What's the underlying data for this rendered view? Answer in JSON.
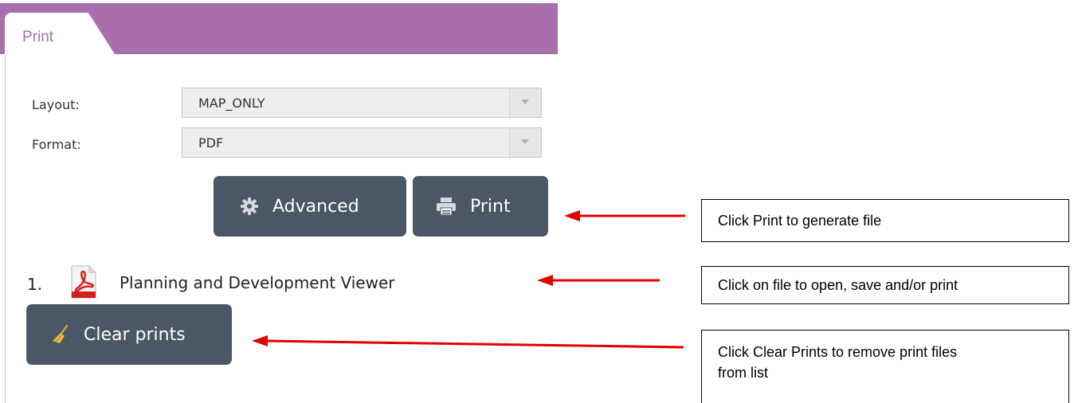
{
  "panel": {
    "tab_label": "Print",
    "layout": {
      "label": "Layout:",
      "value": "MAP_ONLY"
    },
    "format": {
      "label": "Format:",
      "value": "PDF"
    },
    "advanced_label": "Advanced",
    "print_label": "Print",
    "prints": [
      {
        "number": "1.",
        "name": "Planning and Development Viewer",
        "icon": "pdf-icon"
      }
    ],
    "clear_label": "Clear prints"
  },
  "annotations": [
    {
      "text": "Click Print to generate file"
    },
    {
      "text": "Click on file to open, save and/or print"
    },
    {
      "text": "Click Clear Prints to remove print files from list"
    }
  ],
  "colors": {
    "header": "#a86fac",
    "button": "#4b5765",
    "arrow": "#e00000"
  }
}
